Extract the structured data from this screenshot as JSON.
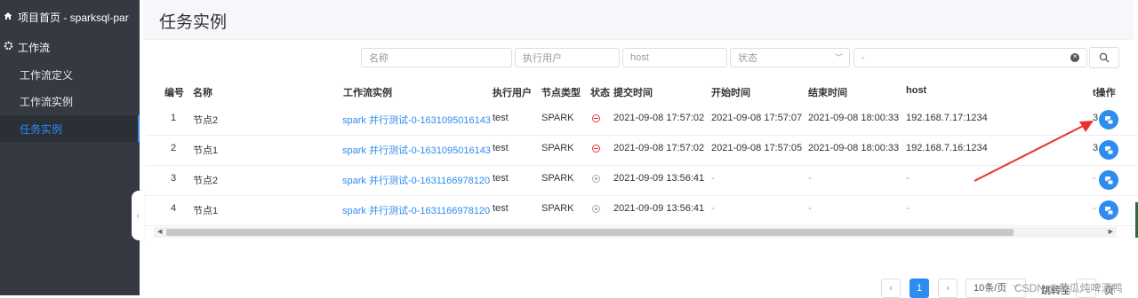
{
  "sidebar": {
    "home_label": "项目首页 - sparksql-par",
    "group_label": "工作流",
    "items": [
      {
        "label": "工作流定义"
      },
      {
        "label": "工作流实例"
      },
      {
        "label": "任务实例"
      }
    ]
  },
  "page_title": "任务实例",
  "filters": {
    "name_placeholder": "名称",
    "user_placeholder": "执行用户",
    "host_placeholder": "host",
    "state_placeholder": "状态",
    "date_range": "-"
  },
  "table": {
    "headers": [
      "编号",
      "名称",
      "工作流实例",
      "执行用户",
      "节点类型",
      "状态",
      "提交时间",
      "开始时间",
      "结束时间",
      "host",
      "t操作"
    ],
    "rows": [
      {
        "id": "1",
        "name": "节点2",
        "instance": "spark 并行测试-0-1631095016143",
        "user": "test",
        "type": "SPARK",
        "status": "stop",
        "submit": "2021-09-08 17:57:02",
        "start": "2021-09-08 17:57:07",
        "end": "2021-09-08 18:00:33",
        "host": "192.168.7.17:1234",
        "extra": "3"
      },
      {
        "id": "2",
        "name": "节点1",
        "instance": "spark 并行测试-0-1631095016143",
        "user": "test",
        "type": "SPARK",
        "status": "stop",
        "submit": "2021-09-08 17:57:02",
        "start": "2021-09-08 17:57:05",
        "end": "2021-09-08 18:00:33",
        "host": "192.168.7.16:1234",
        "extra": "3"
      },
      {
        "id": "3",
        "name": "节点2",
        "instance": "spark 并行测试-0-1631166978120",
        "user": "test",
        "type": "SPARK",
        "status": "wait",
        "submit": "2021-09-09 13:56:41",
        "start": "-",
        "end": "-",
        "host": "-",
        "extra": "-"
      },
      {
        "id": "4",
        "name": "节点1",
        "instance": "spark 并行测试-0-1631166978120",
        "user": "test",
        "type": "SPARK",
        "status": "wait",
        "submit": "2021-09-09 13:56:41",
        "start": "-",
        "end": "-",
        "host": "-",
        "extra": "-"
      }
    ]
  },
  "pagination": {
    "current_page": "1",
    "page_size": "10条/页",
    "jump_label": "跳转至",
    "page_label": "页"
  },
  "watermark": "CSDN @黄瓜炖啤酒鸭",
  "colors": {
    "primary": "#2d8cf0",
    "sidebar": "#353a42",
    "annotation_arrow": "#e8312f"
  },
  "icons": {
    "home": "home-icon",
    "group": "gear-icon",
    "search": "search-icon",
    "action": "view-log-icon"
  }
}
